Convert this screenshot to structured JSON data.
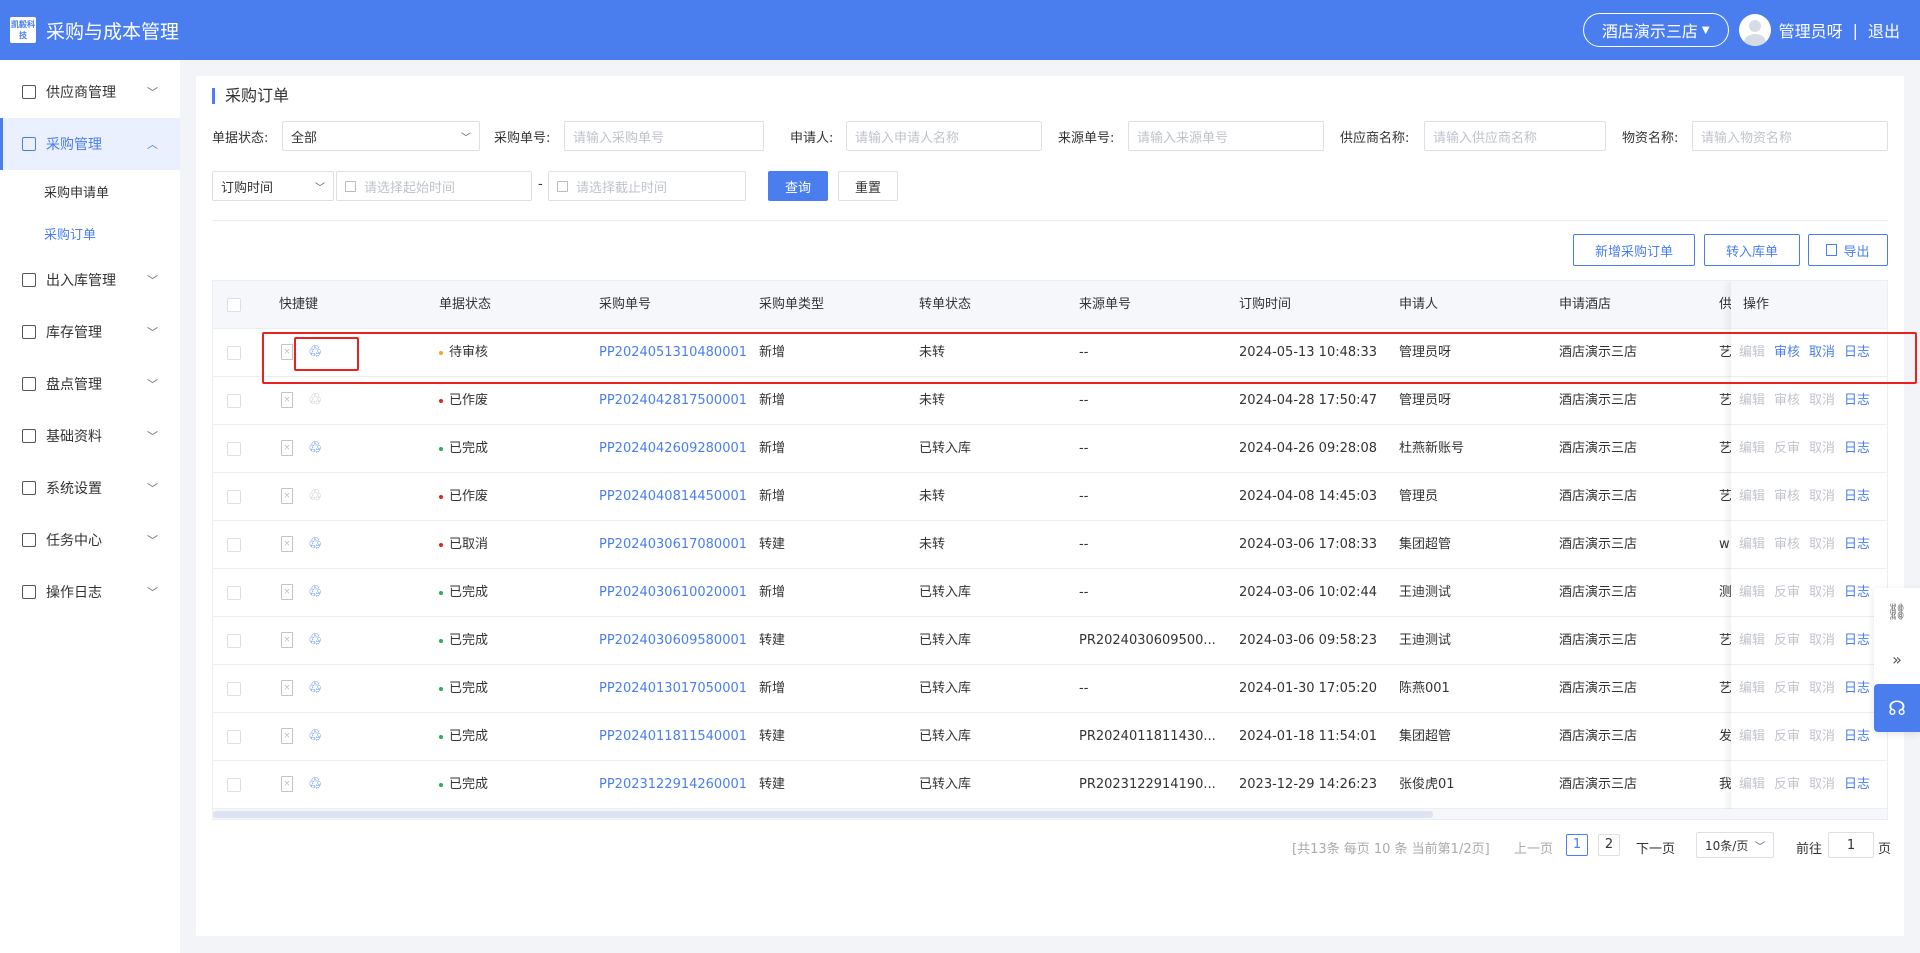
{
  "header": {
    "logo_text": "凯毅科技",
    "app_title": "采购与成本管理",
    "store": "酒店演示三店",
    "user": "管理员呀",
    "separator": "|",
    "logout": "退出"
  },
  "sidebar": {
    "items": [
      {
        "label": "供应商管理",
        "icon": "supplier-icon"
      },
      {
        "label": "采购管理",
        "icon": "purchase-icon",
        "active": true
      },
      {
        "label": "出入库管理",
        "icon": "stock-io-icon"
      },
      {
        "label": "库存管理",
        "icon": "inventory-icon"
      },
      {
        "label": "盘点管理",
        "icon": "stocktake-icon"
      },
      {
        "label": "基础资料",
        "icon": "basic-data-icon"
      },
      {
        "label": "系统设置",
        "icon": "gear-icon"
      },
      {
        "label": "任务中心",
        "icon": "task-icon"
      },
      {
        "label": "操作日志",
        "icon": "log-icon"
      }
    ],
    "sub_items": [
      {
        "label": "采购申请单"
      },
      {
        "label": "采购订单",
        "active": true
      }
    ]
  },
  "page": {
    "title": "采购订单"
  },
  "filters": {
    "status_label": "单据状态:",
    "status_value": "全部",
    "order_no_label": "采购单号:",
    "order_no_placeholder": "请输入采购单号",
    "applicant_label": "申请人:",
    "applicant_placeholder": "请输入申请人名称",
    "source_label": "来源单号:",
    "source_placeholder": "请输入来源单号",
    "supplier_label": "供应商名称:",
    "supplier_placeholder": "请输入供应商名称",
    "material_label": "物资名称:",
    "material_placeholder": "请输入物资名称",
    "time_type": "订购时间",
    "start_placeholder": "请选择起始时间",
    "dash": "-",
    "end_placeholder": "请选择截止时间",
    "query": "查询",
    "reset": "重置"
  },
  "actions": {
    "add": "新增采购订单",
    "to_stock": "转入库单",
    "export": "导出"
  },
  "table": {
    "headers": [
      "快捷键",
      "单据状态",
      "采购单号",
      "采购单类型",
      "转单状态",
      "来源单号",
      "订购时间",
      "申请人",
      "申请酒店",
      "供",
      "操作"
    ],
    "status_colors": {
      "待审核": "#f5a623",
      "已作废": "#e8231f",
      "已完成": "#2bb04a",
      "已取消": "#e8231f"
    },
    "rows": [
      {
        "status": "待审核",
        "order_no": "PP2024051310480001",
        "type": "新增",
        "transfer": "未转",
        "source": "--",
        "time": "2024-05-13 10:48:33",
        "applicant": "管理员呀",
        "hotel": "酒店演示三店",
        "supplier": "艺",
        "ops": [
          "编辑",
          "审核",
          "取消",
          "日志"
        ],
        "ops_enabled": [
          false,
          true,
          true,
          true
        ],
        "quick_enabled": true
      },
      {
        "status": "已作废",
        "order_no": "PP2024042817500001",
        "type": "新增",
        "transfer": "未转",
        "source": "--",
        "time": "2024-04-28 17:50:47",
        "applicant": "管理员呀",
        "hotel": "酒店演示三店",
        "supplier": "艺",
        "ops": [
          "编辑",
          "审核",
          "取消",
          "日志"
        ],
        "ops_enabled": [
          false,
          false,
          false,
          true
        ],
        "quick_enabled": false
      },
      {
        "status": "已完成",
        "order_no": "PP2024042609280001",
        "type": "新增",
        "transfer": "已转入库",
        "source": "--",
        "time": "2024-04-26 09:28:08",
        "applicant": "杜燕新账号",
        "hotel": "酒店演示三店",
        "supplier": "艺",
        "ops": [
          "编辑",
          "反审",
          "取消",
          "日志"
        ],
        "ops_enabled": [
          false,
          false,
          false,
          true
        ],
        "quick_enabled": true
      },
      {
        "status": "已作废",
        "order_no": "PP2024040814450001",
        "type": "新增",
        "transfer": "未转",
        "source": "--",
        "time": "2024-04-08 14:45:03",
        "applicant": "管理员",
        "hotel": "酒店演示三店",
        "supplier": "艺",
        "ops": [
          "编辑",
          "审核",
          "取消",
          "日志"
        ],
        "ops_enabled": [
          false,
          false,
          false,
          true
        ],
        "quick_enabled": false
      },
      {
        "status": "已取消",
        "order_no": "PP2024030617080001",
        "type": "转建",
        "transfer": "未转",
        "source": "--",
        "time": "2024-03-06 17:08:33",
        "applicant": "集团超管",
        "hotel": "酒店演示三店",
        "supplier": "w",
        "ops": [
          "编辑",
          "审核",
          "取消",
          "日志"
        ],
        "ops_enabled": [
          false,
          false,
          false,
          true
        ],
        "quick_enabled": true
      },
      {
        "status": "已完成",
        "order_no": "PP2024030610020001",
        "type": "新增",
        "transfer": "已转入库",
        "source": "--",
        "time": "2024-03-06 10:02:44",
        "applicant": "王迪测试",
        "hotel": "酒店演示三店",
        "supplier": "测",
        "ops": [
          "编辑",
          "反审",
          "取消",
          "日志"
        ],
        "ops_enabled": [
          false,
          false,
          false,
          true
        ],
        "quick_enabled": true
      },
      {
        "status": "已完成",
        "order_no": "PP2024030609580001",
        "type": "转建",
        "transfer": "已转入库",
        "source": "PR2024030609500...",
        "time": "2024-03-06 09:58:23",
        "applicant": "王迪测试",
        "hotel": "酒店演示三店",
        "supplier": "艺",
        "ops": [
          "编辑",
          "反审",
          "取消",
          "日志"
        ],
        "ops_enabled": [
          false,
          false,
          false,
          true
        ],
        "quick_enabled": true
      },
      {
        "status": "已完成",
        "order_no": "PP2024013017050001",
        "type": "新增",
        "transfer": "已转入库",
        "source": "--",
        "time": "2024-01-30 17:05:20",
        "applicant": "陈燕001",
        "hotel": "酒店演示三店",
        "supplier": "艺",
        "ops": [
          "编辑",
          "反审",
          "取消",
          "日志"
        ],
        "ops_enabled": [
          false,
          false,
          false,
          true
        ],
        "quick_enabled": true
      },
      {
        "status": "已完成",
        "order_no": "PP2024011811540001",
        "type": "转建",
        "transfer": "已转入库",
        "source": "PR2024011811430...",
        "time": "2024-01-18 11:54:01",
        "applicant": "集团超管",
        "hotel": "酒店演示三店",
        "supplier": "发",
        "ops": [
          "编辑",
          "反审",
          "取消",
          "日志"
        ],
        "ops_enabled": [
          false,
          false,
          false,
          true
        ],
        "quick_enabled": true
      },
      {
        "status": "已完成",
        "order_no": "PP2023122914260001",
        "type": "转建",
        "transfer": "已转入库",
        "source": "PR2023122914190...",
        "time": "2023-12-29 14:26:23",
        "applicant": "张俊虎01",
        "hotel": "酒店演示三店",
        "supplier": "我",
        "ops": [
          "编辑",
          "反审",
          "取消",
          "日志"
        ],
        "ops_enabled": [
          false,
          false,
          false,
          true
        ],
        "quick_enabled": true
      }
    ]
  },
  "pagination": {
    "summary": "[共13条 每页 10 条 当前第1/2页]",
    "prev": "上一页",
    "pages": [
      "1",
      "2"
    ],
    "next": "下一页",
    "page_size": "10条/页",
    "goto_label": "前往",
    "goto_value": "1",
    "goto_suffix": "页"
  },
  "accent_color": "#4a7eef",
  "highlight_color": "#e8231f"
}
